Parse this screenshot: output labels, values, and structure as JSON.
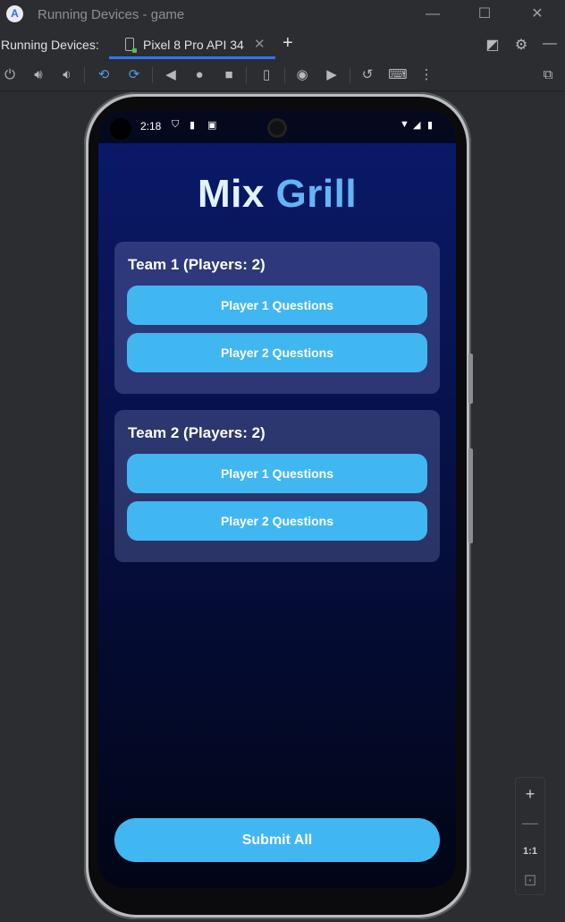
{
  "window": {
    "title": "Running Devices - game",
    "minimize": "—",
    "maximize": "☐",
    "close": "✕"
  },
  "tabbar": {
    "label": "Running Devices:",
    "device_tab": "Pixel 8 Pro API 34",
    "close": "✕",
    "add": "+"
  },
  "toolbar": {
    "icons": [
      "power-icon",
      "volume-up-icon",
      "volume-down-icon",
      "rotate-left-icon",
      "rotate-right-icon",
      "back-icon",
      "home-icon",
      "overview-icon",
      "device-frame-icon",
      "screenshot-icon",
      "screen-record-icon",
      "reset-icon",
      "keyboard-icon",
      "more-icon"
    ]
  },
  "zoom": {
    "in": "+",
    "out": "—",
    "actual": "1:1",
    "fit": "⊡"
  },
  "status_bar": {
    "time": "2:18"
  },
  "app": {
    "title_part1": "Mix",
    "title_part2": "Grill",
    "teams": [
      {
        "title": "Team 1 (Players: 2)",
        "buttons": [
          "Player 1 Questions",
          "Player 2 Questions"
        ]
      },
      {
        "title": "Team 2 (Players: 2)",
        "buttons": [
          "Player 1 Questions",
          "Player 2 Questions"
        ]
      }
    ],
    "submit": "Submit All"
  },
  "colors": {
    "accent": "#41b7f2",
    "title_light": "#e3f2fd",
    "title_blue": "#64b5f6",
    "ide_bg": "#2b2d30"
  }
}
